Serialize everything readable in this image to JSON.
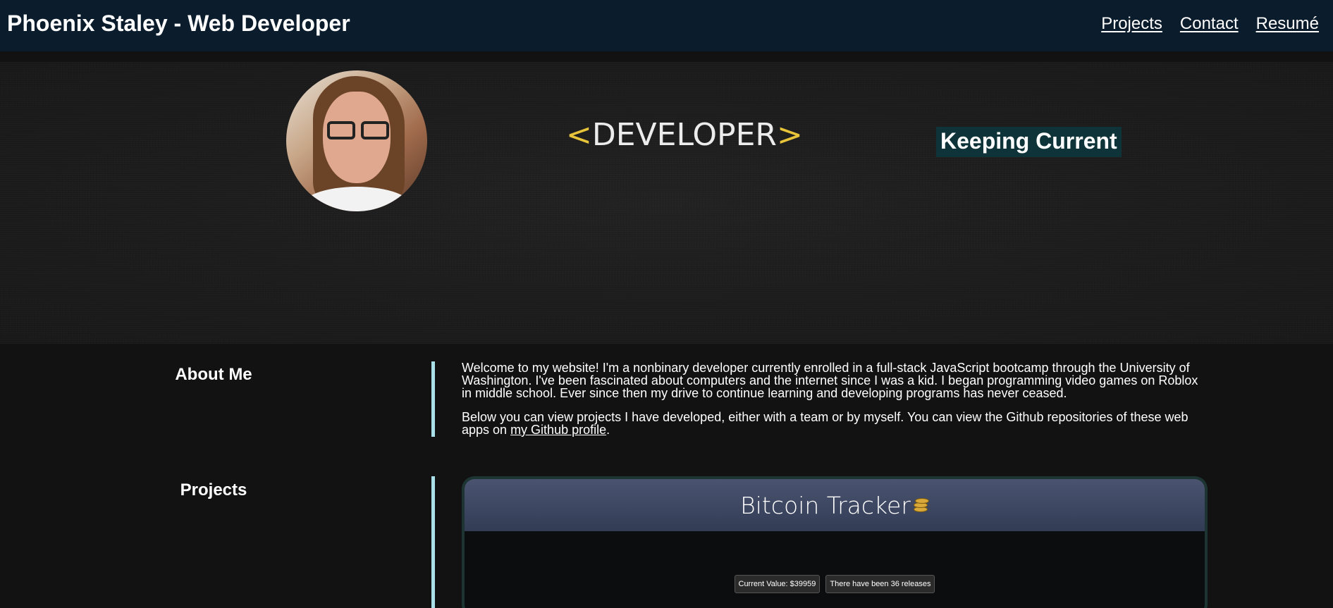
{
  "header": {
    "title": "Phoenix Staley - Web Developer",
    "nav": [
      "Projects",
      "Contact",
      "Resumé"
    ]
  },
  "hero": {
    "logo_open": "<",
    "logo_text": "DEVELOPER",
    "logo_close": ">",
    "tagline": "Keeping Current"
  },
  "about": {
    "heading": "About Me",
    "paragraph1": "Welcome to my website! I'm a nonbinary developer currently enrolled in a full-stack JavaScript bootcamp through the University of Washington. I've been fascinated about computers and the internet since I was a kid. I began programming video games on Roblox in middle school. Ever since then my drive to continue learning and developing programs has never ceased.",
    "paragraph2_pre": "Below you can view projects I have developed, either with a team or by myself. You can view the Github repositories of these web apps on ",
    "github_link": "my Github profile",
    "paragraph2_post": "."
  },
  "projects": {
    "heading": "Projects",
    "items": [
      {
        "title": "Bitcoin Tracker",
        "icon": "coin-stack-icon",
        "current_value": "Current Value: $39959",
        "releases": "There have been 36 releases"
      }
    ]
  },
  "colors": {
    "header_bg": "#0b1c2c",
    "page_bg": "#121212",
    "accent_divider": "#a9dfe8",
    "logo_bracket": "#e8c43a",
    "tagline_bg": "#0e3338"
  }
}
